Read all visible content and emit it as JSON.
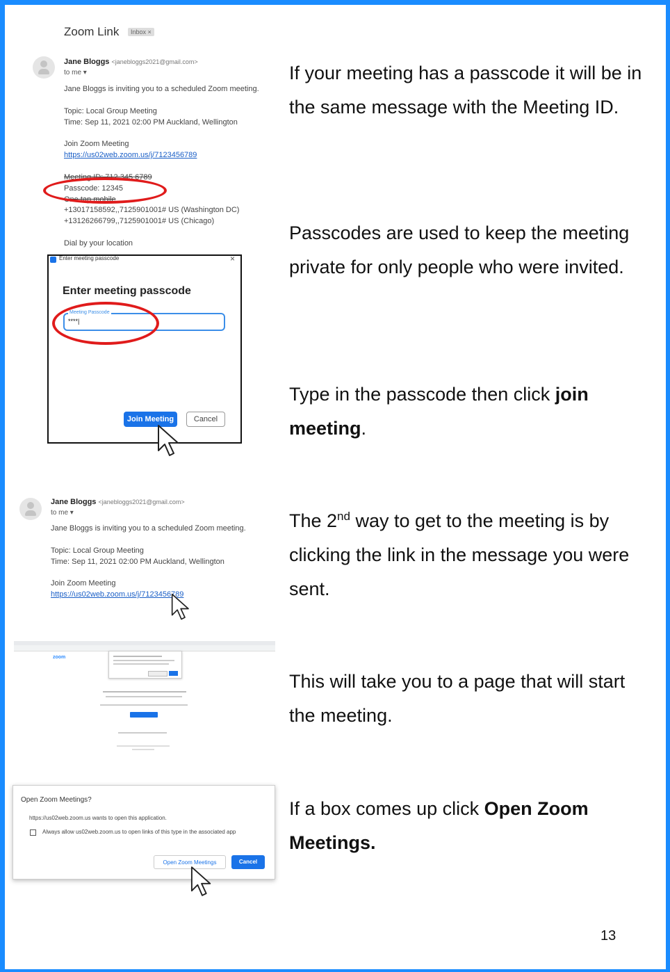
{
  "email1": {
    "subject": "Zoom Link",
    "badge": "Inbox ×",
    "sender_name": "Jane Bloggs",
    "sender_email": "<janebloggs2021@gmail.com>",
    "to_line": "to me ▾",
    "invite": "Jane Bloggs is inviting you to a scheduled Zoom meeting.",
    "topic": "Topic: Local Group Meeting",
    "time": "Time: Sep 11, 2021 02:00 PM Auckland, Wellington",
    "join_label": "Join Zoom Meeting",
    "link": "https://us02web.zoom.us/j/7123456789",
    "meeting_id": "Meeting ID: 712 345 6789",
    "passcode": "Passcode: 12345",
    "one_tap": "One tap mobile",
    "phone1": "+13017158592,,7125901001# US (Washington DC)",
    "phone2": "+13126266799,,7125901001# US (Chicago)",
    "dial": "Dial by your location"
  },
  "dialog": {
    "window_title": "Enter meeting passcode",
    "heading": "Enter meeting passcode",
    "field_label": "Meeting Passcode",
    "field_value": "****|",
    "join_button": "Join Meeting",
    "cancel_button": "Cancel"
  },
  "email2": {
    "sender_name": "Jane Bloggs",
    "sender_email": "<janebloggs2021@gmail.com>",
    "to_line": "to me ▾",
    "invite": "Jane Bloggs is inviting you to a scheduled Zoom meeting.",
    "topic": "Topic: Local Group Meeting",
    "time": "Time: Sep 11, 2021 02:00 PM Auckland, Wellington",
    "join_label": "Join Zoom Meeting",
    "link": "https://us02web.zoom.us/j/7123456789"
  },
  "browser": {
    "logo": "zoom"
  },
  "open_dialog": {
    "title": "Open Zoom Meetings?",
    "message": "https://us02web.zoom.us wants to open this application.",
    "checkbox_label": "Always allow us02web.zoom.us to open links of this type in the associated app",
    "open_button": "Open Zoom Meetings",
    "cancel_button": "Cancel"
  },
  "text": {
    "p1": "If your meeting has a passcode it will be in the same message with the Meeting ID.",
    "p2": "Passcodes are used to keep the meeting private for only people who were invited.",
    "p3a": "Type in the passcode then click ",
    "p3b": "join meeting",
    "p3c": ".",
    "p4a": "The 2",
    "p4sup": "nd",
    "p4b": " way to get to the meeting is by clicking the link in the message you were sent.",
    "p5": "This will take you to a page that will start the meeting.",
    "p6a": "If a box comes up click ",
    "p6b": "Open Zoom Meetings."
  },
  "page_number": "13",
  "colors": {
    "border": "#1a8cff",
    "highlight_circle": "#e01b1b",
    "button_blue": "#1a73e8"
  }
}
